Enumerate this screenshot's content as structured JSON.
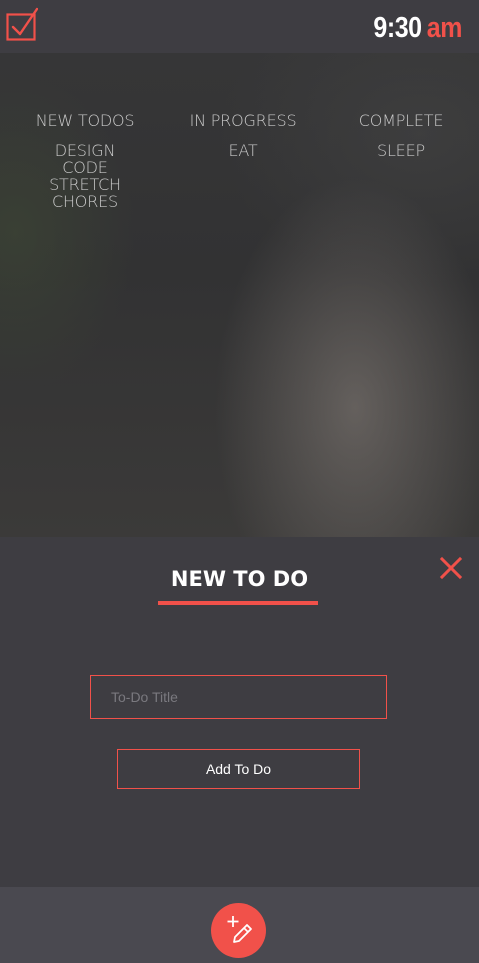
{
  "header": {
    "time": "9:30",
    "ampm": "am"
  },
  "board": {
    "columns": [
      {
        "title": "NEW TODOS",
        "items": [
          "DESIGN",
          "CODE",
          "STRETCH",
          "CHORES"
        ]
      },
      {
        "title": "IN PROGRESS",
        "items": [
          "EAT"
        ]
      },
      {
        "title": "COMPLETE",
        "items": [
          "SLEEP"
        ]
      }
    ]
  },
  "new_todo": {
    "title": "NEW TO DO",
    "input_placeholder": "To-Do Title",
    "input_value": "",
    "submit_label": "Add To Do"
  },
  "colors": {
    "accent": "#f1514a",
    "background": "#3e3d42",
    "bottom_bar": "#4a4950",
    "text": "#ffffff",
    "muted_text": "#c9c9c9"
  },
  "icons": {
    "logo": "checkbox-check-icon",
    "close": "close-icon",
    "fab": "add-edit-pencil-icon"
  }
}
